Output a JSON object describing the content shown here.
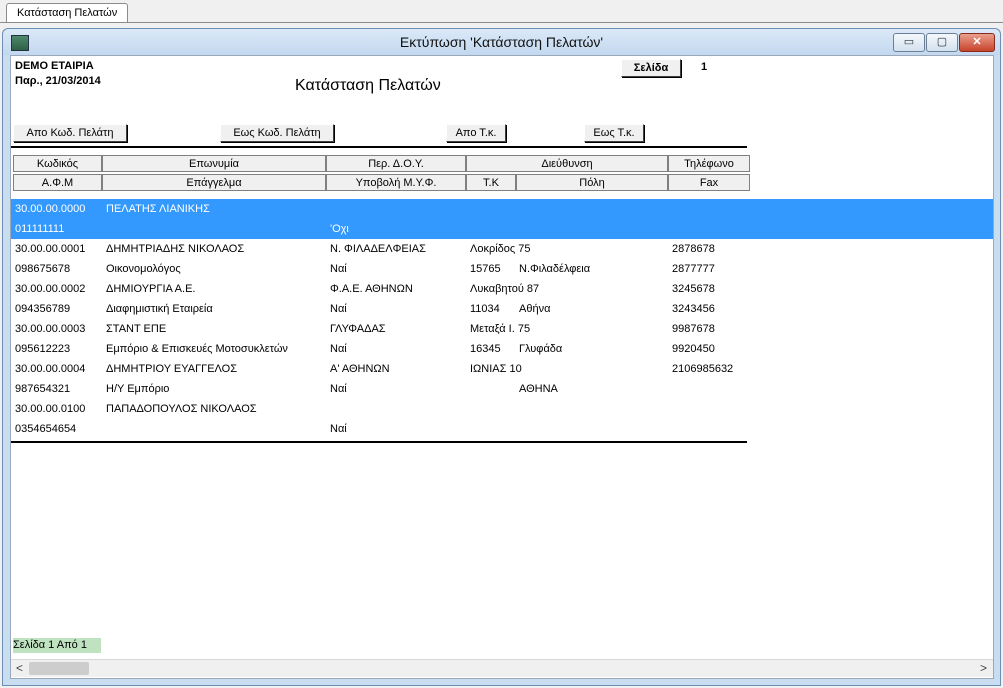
{
  "tab": {
    "label": "Κατάσταση Πελατών"
  },
  "window": {
    "title": "Εκτύπωση 'Κατάσταση Πελατών'",
    "min": "▭",
    "max": "▢",
    "close": "✕"
  },
  "report": {
    "company": "DEMO ΕΤΑΙΡΙΑ",
    "date": "Παρ., 21/03/2014",
    "title": "Κατάσταση Πελατών",
    "page_label": "Σελίδα",
    "page_number": "1"
  },
  "filters": {
    "from_code": "Απο Κωδ. Πελάτη",
    "to_code": "Εως Κωδ. Πελάτη",
    "from_zip": "Απο Τ.κ.",
    "to_zip": "Εως Τ.κ."
  },
  "headers": {
    "row1": [
      "Κωδικός",
      "Επωνυμία",
      "Περ. Δ.Ο.Υ.",
      "Διεύθυνση",
      "Τηλέφωνο"
    ],
    "row2": [
      "Α.Φ.Μ",
      "Επάγγελμα",
      "Υποβολή Μ.Υ.Φ.",
      "Τ.Κ",
      "Πόλη",
      "Fax"
    ]
  },
  "customers": [
    {
      "code": "30.00.00.0000",
      "name": "ΠΕΛΑΤΗΣ ΛΙΑΝΙΚΗΣ",
      "doy": "",
      "address": "",
      "phone": "",
      "afm": "011111111",
      "profession": "",
      "myf": "'Οχι",
      "zip": "",
      "city": "",
      "fax": "",
      "selected": true
    },
    {
      "code": "30.00.00.0001",
      "name": "ΔΗΜΗΤΡΙΑΔΗΣ ΝΙΚΟΛΑΟΣ",
      "doy": "Ν. ΦΙΛΑΔΕΛΦΕΙΑΣ",
      "address": "Λοκρίδος 75",
      "phone": "2878678",
      "afm": "098675678",
      "profession": "Οικονομολόγος",
      "myf": "Ναί",
      "zip": "15765",
      "city": "Ν.Φιλαδέλφεια",
      "fax": "2877777"
    },
    {
      "code": "30.00.00.0002",
      "name": "ΔΗΜΙΟΥΡΓΙΑ Α.Ε.",
      "doy": "Φ.Α.Ε. ΑΘΗΝΩΝ",
      "address": "Λυκαβητού 87",
      "phone": "3245678",
      "afm": "094356789",
      "profession": "Διαφημιστική Εταιρεία",
      "myf": "Ναί",
      "zip": "11034",
      "city": "Αθήνα",
      "fax": "3243456"
    },
    {
      "code": "30.00.00.0003",
      "name": "ΣΤΑΝΤ ΕΠΕ",
      "doy": "ΓΛΥΦΑΔΑΣ",
      "address": "Μεταξά Ι. 75",
      "phone": "9987678",
      "afm": "095612223",
      "profession": "Εμπόριο & Επισκευές Μοτοσυκλετών",
      "myf": "Ναί",
      "zip": "16345",
      "city": "Γλυφάδα",
      "fax": "9920450"
    },
    {
      "code": "30.00.00.0004",
      "name": "ΔΗΜΗΤΡΙΟΥ ΕΥΑΓΓΕΛΟΣ",
      "doy": "Α' ΑΘΗΝΩΝ",
      "address": "ΙΩΝΙΑΣ 10",
      "phone": "2106985632",
      "afm": "987654321",
      "profession": "Η/Υ Εμπόριο",
      "myf": "Ναί",
      "zip": "",
      "city": "ΑΘΗΝΑ",
      "fax": ""
    },
    {
      "code": "30.00.00.0100",
      "name": "ΠΑΠΑΔΟΠΟΥΛΟΣ ΝΙΚΟΛΑΟΣ",
      "doy": "",
      "address": "",
      "phone": "",
      "afm": "0354654654",
      "profession": "",
      "myf": "Ναί",
      "zip": "",
      "city": "",
      "fax": ""
    }
  ],
  "status": "Σελίδα 1 Από 1",
  "scroll": {
    "left": "<",
    "right": ">"
  }
}
